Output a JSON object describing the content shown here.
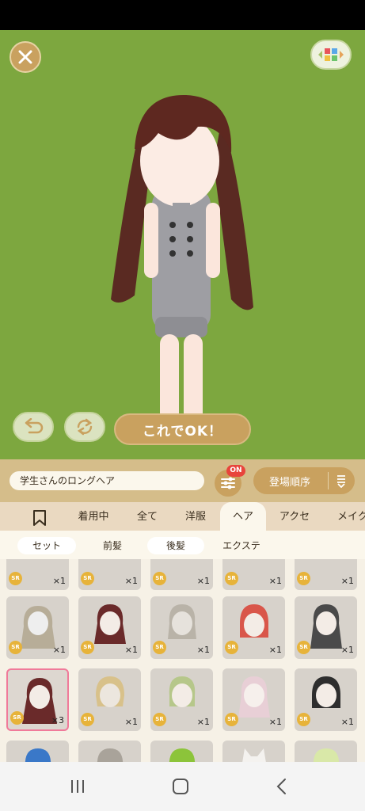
{
  "colors": {
    "stage_bg": "#7da73f",
    "accent": "#c9a15f",
    "on_badge": "#e8443c",
    "selected_border": "#f07a9a",
    "rarity": "#e7b33a"
  },
  "stage": {
    "close_icon": "close-icon",
    "palette_icon": "color-palette-icon",
    "undo_icon": "undo-icon",
    "random_icon": "shuffle-icon",
    "ok_label": "これでOK！"
  },
  "name_bar": {
    "item_name": "学生さんのロングヘア",
    "filter_badge": "ON",
    "filter_icon": "sliders-icon",
    "sort_label": "登場順序",
    "sort_icon": "sort-order-icon"
  },
  "category_tabs": {
    "bookmark_icon": "bookmark-icon",
    "tabs": [
      "着用中",
      "全て",
      "洋服",
      "ヘア",
      "アクセ",
      "メイク"
    ],
    "active": "ヘア"
  },
  "sub_tabs": {
    "tabs": [
      "セット",
      "前髪",
      "後髪",
      "エクステ"
    ],
    "active": [
      "セット",
      "後髪"
    ]
  },
  "items": {
    "rarity_label": "SR",
    "rows": [
      [
        "×1",
        "×1",
        "×1",
        "×1",
        "×1"
      ],
      [
        "×1",
        "×1",
        "×1",
        "×1",
        "×1"
      ],
      [
        "×3",
        "×1",
        "×1",
        "×1",
        "×1"
      ],
      [
        "",
        "",
        "",
        "",
        ""
      ]
    ]
  },
  "nav": {
    "recent_icon": "recent-apps-icon",
    "home_icon": "home-icon",
    "back_icon": "back-icon"
  }
}
